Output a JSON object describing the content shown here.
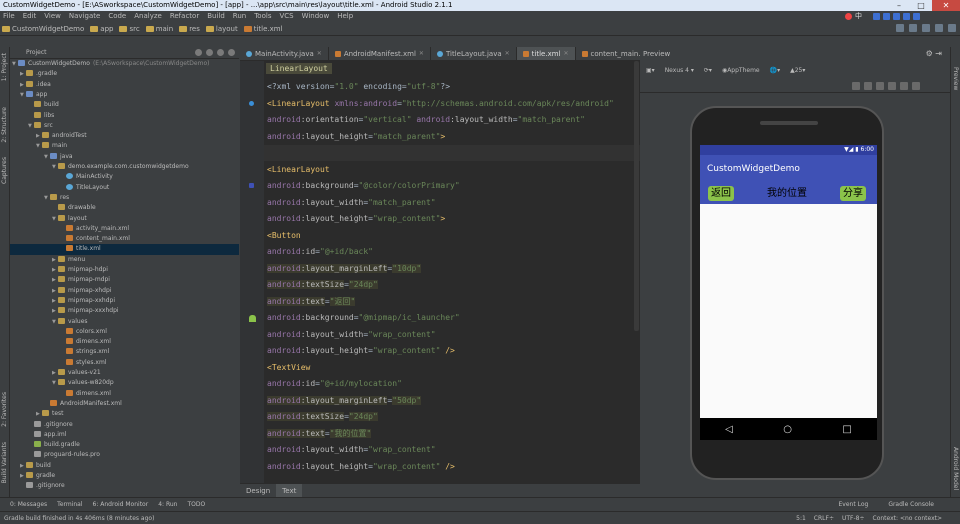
{
  "window": {
    "title": "CustomWidgetDemo - [E:\\ASworkspace\\CustomWidgetDemo] - [app] - ...\\app\\src\\main\\res\\layout\\title.xml - Android Studio 2.1.1"
  },
  "menu": [
    "File",
    "Edit",
    "View",
    "Navigate",
    "Code",
    "Analyze",
    "Refactor",
    "Build",
    "Run",
    "Tools",
    "VCS",
    "Window",
    "Help"
  ],
  "ime": {
    "label": "中"
  },
  "breadcrumbs": [
    "CustomWidgetDemo",
    "app",
    "src",
    "main",
    "res",
    "layout",
    "title.xml"
  ],
  "left_strip": [
    "1: Project",
    "2: Structure",
    "Captures",
    "2: Favorites",
    "Build Variants"
  ],
  "right_strip": [
    "Preview",
    "Android Model"
  ],
  "project": {
    "header": "Project",
    "tree": [
      {
        "label": "CustomWidgetDemo",
        "extra": "(E:\\ASworkspace\\CustomWidgetDemo)",
        "indent": 0,
        "icon": "fb",
        "arrow": "▼"
      },
      {
        "label": ".gradle",
        "indent": 1,
        "icon": "fo",
        "arrow": "▶"
      },
      {
        "label": ".idea",
        "indent": 1,
        "icon": "fo",
        "arrow": "▶"
      },
      {
        "label": "app",
        "indent": 1,
        "icon": "fb",
        "arrow": "▼"
      },
      {
        "label": "build",
        "indent": 2,
        "icon": "fo",
        "arrow": ""
      },
      {
        "label": "libs",
        "indent": 2,
        "icon": "fo",
        "arrow": ""
      },
      {
        "label": "src",
        "indent": 2,
        "icon": "fo",
        "arrow": "▼"
      },
      {
        "label": "androidTest",
        "indent": 3,
        "icon": "fo",
        "arrow": "▶"
      },
      {
        "label": "main",
        "indent": 3,
        "icon": "fo",
        "arrow": "▼"
      },
      {
        "label": "java",
        "indent": 4,
        "icon": "fb",
        "arrow": "▼"
      },
      {
        "label": "demo.example.com.customwidgetdemo",
        "indent": 5,
        "icon": "fo",
        "arrow": "▼"
      },
      {
        "label": "MainActivity",
        "indent": 6,
        "icon": "fc",
        "arrow": ""
      },
      {
        "label": "TitleLayout",
        "indent": 6,
        "icon": "fc",
        "arrow": ""
      },
      {
        "label": "res",
        "indent": 4,
        "icon": "fo",
        "arrow": "▼"
      },
      {
        "label": "drawable",
        "indent": 5,
        "icon": "fo",
        "arrow": ""
      },
      {
        "label": "layout",
        "indent": 5,
        "icon": "fo",
        "arrow": "▼"
      },
      {
        "label": "activity_main.xml",
        "indent": 6,
        "icon": "fx",
        "arrow": ""
      },
      {
        "label": "content_main.xml",
        "indent": 6,
        "icon": "fx",
        "arrow": ""
      },
      {
        "label": "title.xml",
        "indent": 6,
        "icon": "fx",
        "arrow": "",
        "selected": true
      },
      {
        "label": "menu",
        "indent": 5,
        "icon": "fo",
        "arrow": "▶"
      },
      {
        "label": "mipmap-hdpi",
        "indent": 5,
        "icon": "fo",
        "arrow": "▶"
      },
      {
        "label": "mipmap-mdpi",
        "indent": 5,
        "icon": "fo",
        "arrow": "▶"
      },
      {
        "label": "mipmap-xhdpi",
        "indent": 5,
        "icon": "fo",
        "arrow": "▶"
      },
      {
        "label": "mipmap-xxhdpi",
        "indent": 5,
        "icon": "fo",
        "arrow": "▶"
      },
      {
        "label": "mipmap-xxxhdpi",
        "indent": 5,
        "icon": "fo",
        "arrow": "▶"
      },
      {
        "label": "values",
        "indent": 5,
        "icon": "fo",
        "arrow": "▼"
      },
      {
        "label": "colors.xml",
        "indent": 6,
        "icon": "fx",
        "arrow": ""
      },
      {
        "label": "dimens.xml",
        "indent": 6,
        "icon": "fx",
        "arrow": ""
      },
      {
        "label": "strings.xml",
        "indent": 6,
        "icon": "fx",
        "arrow": ""
      },
      {
        "label": "styles.xml",
        "indent": 6,
        "icon": "fx",
        "arrow": ""
      },
      {
        "label": "values-v21",
        "indent": 5,
        "icon": "fo",
        "arrow": "▶"
      },
      {
        "label": "values-w820dp",
        "indent": 5,
        "icon": "fo",
        "arrow": "▼"
      },
      {
        "label": "dimens.xml",
        "indent": 6,
        "icon": "fx",
        "arrow": ""
      },
      {
        "label": "AndroidManifest.xml",
        "indent": 4,
        "icon": "fx",
        "arrow": ""
      },
      {
        "label": "test",
        "indent": 3,
        "icon": "fo",
        "arrow": "▶"
      },
      {
        "label": ".gitignore",
        "indent": 2,
        "icon": "ff",
        "arrow": ""
      },
      {
        "label": "app.iml",
        "indent": 2,
        "icon": "ff",
        "arrow": ""
      },
      {
        "label": "build.gradle",
        "indent": 2,
        "icon": "fg",
        "arrow": ""
      },
      {
        "label": "proguard-rules.pro",
        "indent": 2,
        "icon": "ff",
        "arrow": ""
      },
      {
        "label": "build",
        "indent": 1,
        "icon": "fo",
        "arrow": "▶"
      },
      {
        "label": "gradle",
        "indent": 1,
        "icon": "fo",
        "arrow": "▶"
      },
      {
        "label": ".gitignore",
        "indent": 1,
        "icon": "ff",
        "arrow": ""
      }
    ]
  },
  "tabs": [
    {
      "label": "MainActivity.java",
      "icon": "fc"
    },
    {
      "label": "AndroidManifest.xml",
      "icon": "fx"
    },
    {
      "label": "TitleLayout.java",
      "icon": "fc"
    },
    {
      "label": "title.xml",
      "icon": "fx",
      "active": true
    },
    {
      "label": "content_main.xml",
      "icon": "fx"
    }
  ],
  "editor": {
    "breadcrumb": "LinearLayout",
    "lines": [
      [
        [
          "p",
          "<?xml version="
        ],
        [
          "v",
          "\"1.0\""
        ],
        [
          "p",
          " encoding="
        ],
        [
          "v",
          "\"utf-8\""
        ],
        [
          "p",
          "?>"
        ]
      ],
      [
        [
          "t",
          "<LinearLayout "
        ],
        [
          "ns",
          "xmlns:android"
        ],
        [
          "p",
          "="
        ],
        [
          "v",
          "\"http://schemas.android.com/apk/res/android\""
        ]
      ],
      [
        [
          "p",
          "    "
        ],
        [
          "ns",
          "android"
        ],
        [
          "a",
          ":orientation"
        ],
        [
          "p",
          "="
        ],
        [
          "v",
          "\"vertical\""
        ],
        [
          "p",
          " "
        ],
        [
          "ns",
          "android"
        ],
        [
          "a",
          ":layout_width"
        ],
        [
          "p",
          "="
        ],
        [
          "v",
          "\"match_parent\""
        ]
      ],
      [
        [
          "p",
          "    "
        ],
        [
          "ns",
          "android"
        ],
        [
          "a",
          ":layout_height"
        ],
        [
          "p",
          "="
        ],
        [
          "v",
          "\"match_parent\""
        ],
        [
          "t",
          ">"
        ]
      ],
      [
        [
          "p",
          ""
        ]
      ],
      [
        [
          "p",
          "  "
        ],
        [
          "t",
          "<LinearLayout"
        ]
      ],
      [
        [
          "p",
          "        "
        ],
        [
          "ns",
          "android"
        ],
        [
          "a",
          ":background"
        ],
        [
          "p",
          "="
        ],
        [
          "v",
          "\"@color/colorPrimary\""
        ]
      ],
      [
        [
          "p",
          "        "
        ],
        [
          "ns",
          "android"
        ],
        [
          "a",
          ":layout_width"
        ],
        [
          "p",
          "="
        ],
        [
          "v",
          "\"match_parent\""
        ]
      ],
      [
        [
          "p",
          "        "
        ],
        [
          "ns",
          "android"
        ],
        [
          "a",
          ":layout_height"
        ],
        [
          "p",
          "="
        ],
        [
          "v",
          "\"wrap_content\""
        ],
        [
          "t",
          ">"
        ]
      ],
      [
        [
          "p",
          "        "
        ],
        [
          "t",
          "<Button"
        ]
      ],
      [
        [
          "p",
          "            "
        ],
        [
          "ns",
          "android"
        ],
        [
          "a",
          ":id"
        ],
        [
          "p",
          "="
        ],
        [
          "v",
          "\"@+id/back\""
        ]
      ],
      [
        [
          "p",
          "            "
        ],
        [
          "ns",
          "android"
        ],
        [
          "a",
          ":layout_marginLeft"
        ],
        [
          "p",
          "="
        ],
        [
          "v",
          "\"10dp\""
        ]
      ],
      [
        [
          "p",
          "            "
        ],
        [
          "ns",
          "android"
        ],
        [
          "a",
          ":textSize"
        ],
        [
          "p",
          "="
        ],
        [
          "v",
          "\"24dp\""
        ]
      ],
      [
        [
          "p",
          "            "
        ],
        [
          "ns",
          "android"
        ],
        [
          "a",
          ":text"
        ],
        [
          "p",
          "="
        ],
        [
          "v",
          "\"返回\""
        ]
      ],
      [
        [
          "p",
          "            "
        ],
        [
          "ns",
          "android"
        ],
        [
          "a",
          ":background"
        ],
        [
          "p",
          "="
        ],
        [
          "v",
          "\"@mipmap/ic_launcher\""
        ]
      ],
      [
        [
          "p",
          "            "
        ],
        [
          "ns",
          "android"
        ],
        [
          "a",
          ":layout_width"
        ],
        [
          "p",
          "="
        ],
        [
          "v",
          "\"wrap_content\""
        ]
      ],
      [
        [
          "p",
          "            "
        ],
        [
          "ns",
          "android"
        ],
        [
          "a",
          ":layout_height"
        ],
        [
          "p",
          "="
        ],
        [
          "v",
          "\"wrap_content\""
        ],
        [
          "t",
          " />"
        ]
      ],
      [
        [
          "p",
          "        "
        ],
        [
          "t",
          "<TextView"
        ]
      ],
      [
        [
          "p",
          "            "
        ],
        [
          "ns",
          "android"
        ],
        [
          "a",
          ":id"
        ],
        [
          "p",
          "="
        ],
        [
          "v",
          "\"@+id/mylocation\""
        ]
      ],
      [
        [
          "p",
          "            "
        ],
        [
          "ns",
          "android"
        ],
        [
          "a",
          ":layout_marginLeft"
        ],
        [
          "p",
          "="
        ],
        [
          "v",
          "\"50dp\""
        ]
      ],
      [
        [
          "p",
          "            "
        ],
        [
          "ns",
          "android"
        ],
        [
          "a",
          ":textSize"
        ],
        [
          "p",
          "="
        ],
        [
          "v",
          "\"24dp\""
        ]
      ],
      [
        [
          "p",
          "            "
        ],
        [
          "ns",
          "android"
        ],
        [
          "a",
          ":text"
        ],
        [
          "p",
          "="
        ],
        [
          "v",
          "\"我的位置\""
        ]
      ],
      [
        [
          "p",
          "            "
        ],
        [
          "ns",
          "android"
        ],
        [
          "a",
          ":layout_width"
        ],
        [
          "p",
          "="
        ],
        [
          "v",
          "\"wrap_content\""
        ]
      ],
      [
        [
          "p",
          "            "
        ],
        [
          "ns",
          "android"
        ],
        [
          "a",
          ":layout_height"
        ],
        [
          "p",
          "="
        ],
        [
          "v",
          "\"wrap_content\""
        ],
        [
          "t",
          " />"
        ]
      ]
    ]
  },
  "editor_bottom_tabs": [
    "Design",
    "Text"
  ],
  "preview": {
    "header": "Preview",
    "device": "Nexus 4",
    "theme": "AppTheme",
    "api": "25",
    "status_time": "6:00",
    "app_title": "CustomWidgetDemo",
    "back_label": "返回",
    "location_label": "我的位置",
    "share_label": "分享",
    "nav_back": "◁",
    "nav_home": "○",
    "nav_recent": "□"
  },
  "bottom_windows": [
    "0: Messages",
    "Terminal",
    "6: Android Monitor",
    "4: Run",
    "TODO"
  ],
  "bottom_right": [
    "Event Log",
    "Gradle Console"
  ],
  "status": {
    "message": "Gradle build finished in 4s 406ms (8 minutes ago)",
    "position": "5:1",
    "line_sep": "CRLF÷",
    "encoding": "UTF-8÷",
    "context": "Context: <no context>"
  },
  "colors": {
    "primary": "#3f51b5",
    "primary_dark": "#303f9f",
    "button": "#8bc34a",
    "selection": "#0d293e"
  }
}
